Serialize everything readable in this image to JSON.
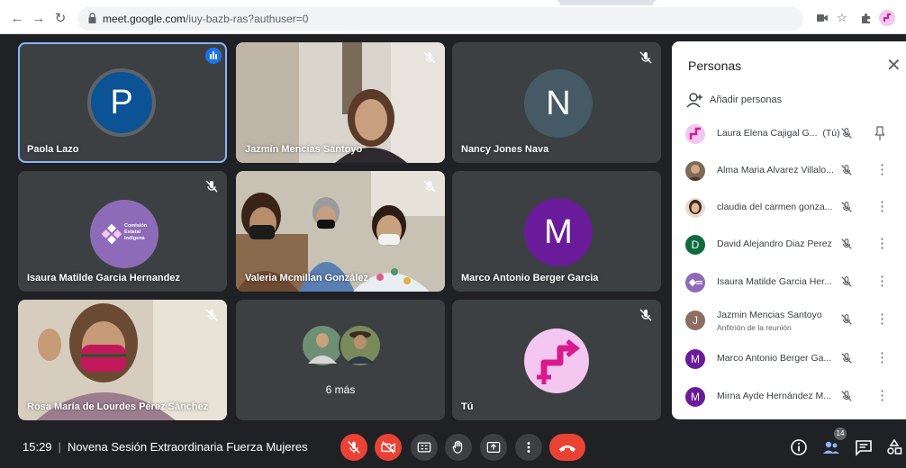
{
  "browser": {
    "url_host": "meet.google.com",
    "url_path": "/iuy-bazb-ras?authuser=0"
  },
  "tiles": [
    {
      "name": "Paola Lazo",
      "initial": "P",
      "avatar_color": "#0b5394",
      "speaking": true
    },
    {
      "name": "Jazmín Mencías Santoyo"
    },
    {
      "name": "Nancy Jones Nava",
      "initial": "N",
      "avatar_color": "#455a64"
    },
    {
      "name": "Isaura Matilde Garcia Hernandez",
      "logo_text": "Comisión Estatal Indígena"
    },
    {
      "name": "Valeria Mcmillan González"
    },
    {
      "name": "Marco Antonio Berger Garcia",
      "initial": "M",
      "avatar_color": "#6a1b9a"
    },
    {
      "name": "Rosa María de Lourdes Pérez Sánchez"
    },
    {
      "more_label": "6 más"
    },
    {
      "name": "Tú"
    }
  ],
  "panel": {
    "title": "Personas",
    "add_label": "Añadir personas",
    "participants": [
      {
        "name": "Laura Elena Cajigal G...",
        "tag": "(Tú)",
        "avatar": "logo"
      },
      {
        "name": "Alma Maria Alvarez Villalo...",
        "avatar": "photo"
      },
      {
        "name": "claudia del carmen gonza...",
        "avatar": "photo"
      },
      {
        "name": "David Alejandro Diaz Perez",
        "initial": "D",
        "avatar_color": "#0f6b3f"
      },
      {
        "name": "Isaura Matilde Garcia Her...",
        "avatar": "logo"
      },
      {
        "name": "Jazmin Mencias Santoyo",
        "sub": "Anfitrión de la reunión",
        "initial": "J",
        "avatar_color": "#8d6e63"
      },
      {
        "name": "Marco Antonio Berger Ga...",
        "initial": "M",
        "avatar_color": "#6a1b9a"
      },
      {
        "name": "Mirna Ayde Hernández M...",
        "initial": "M",
        "avatar_color": "#6a1b9a"
      }
    ]
  },
  "bottom": {
    "time": "15:29",
    "meeting_title": "Novena Sesión Extraordinaria Fuerza Mujeres",
    "participant_count": "14"
  },
  "colors": {
    "accent_red": "#ea4335",
    "logo_magenta": "#d81b8c",
    "active_border": "#8ab4f8"
  }
}
